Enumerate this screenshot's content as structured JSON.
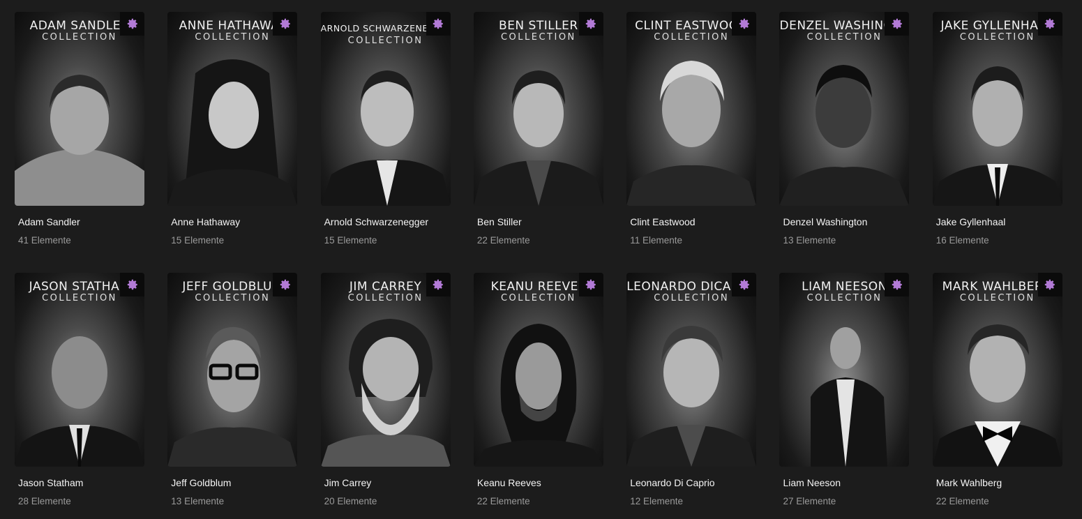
{
  "accent_color": "#b27ad6",
  "gear_icon": "gear-icon",
  "collections": [
    {
      "poster_title": "ADAM SANDLER",
      "poster_sub": "COLLECTION",
      "name": "Adam Sandler",
      "count": "41 Elemente"
    },
    {
      "poster_title": "ANNE HATHAWAY",
      "poster_sub": "COLLECTION",
      "name": "Anne Hathaway",
      "count": "15 Elemente"
    },
    {
      "poster_title": "ARNOLD SCHWARZENEGGER",
      "poster_sub": "COLLECTION",
      "name": "Arnold Schwarzenegger",
      "count": "15 Elemente"
    },
    {
      "poster_title": "BEN STILLER",
      "poster_sub": "COLLECTION",
      "name": "Ben Stiller",
      "count": "22 Elemente"
    },
    {
      "poster_title": "CLINT EASTWOOD",
      "poster_sub": "COLLECTION",
      "name": "Clint Eastwood",
      "count": "11 Elemente"
    },
    {
      "poster_title": "DENZEL WASHINGTON",
      "poster_sub": "COLLECTION",
      "name": "Denzel Washington",
      "count": "13 Elemente"
    },
    {
      "poster_title": "JAKE GYLLENHAAL",
      "poster_sub": "COLLECTION",
      "name": "Jake Gyllenhaal",
      "count": "16 Elemente"
    },
    {
      "poster_title": "JASON STATHAM",
      "poster_sub": "COLLECTION",
      "name": "Jason Statham",
      "count": "28 Elemente"
    },
    {
      "poster_title": "JEFF GOLDBLUM",
      "poster_sub": "COLLECTION",
      "name": "Jeff Goldblum",
      "count": "13 Elemente"
    },
    {
      "poster_title": "JIM CARREY",
      "poster_sub": "COLLECTION",
      "name": "Jim Carrey",
      "count": "20 Elemente"
    },
    {
      "poster_title": "KEANU REEVES",
      "poster_sub": "COLLECTION",
      "name": "Keanu Reeves",
      "count": "22 Elemente"
    },
    {
      "poster_title": "LEONARDO DICAPRIO",
      "poster_sub": "COLLECTION",
      "name": "Leonardo Di Caprio",
      "count": "12 Elemente"
    },
    {
      "poster_title": "LIAM NEESON",
      "poster_sub": "COLLECTION",
      "name": "Liam Neeson",
      "count": "27 Elemente"
    },
    {
      "poster_title": "MARK WAHLBERG",
      "poster_sub": "COLLECTION",
      "name": "Mark Wahlberg",
      "count": "22 Elemente"
    }
  ]
}
